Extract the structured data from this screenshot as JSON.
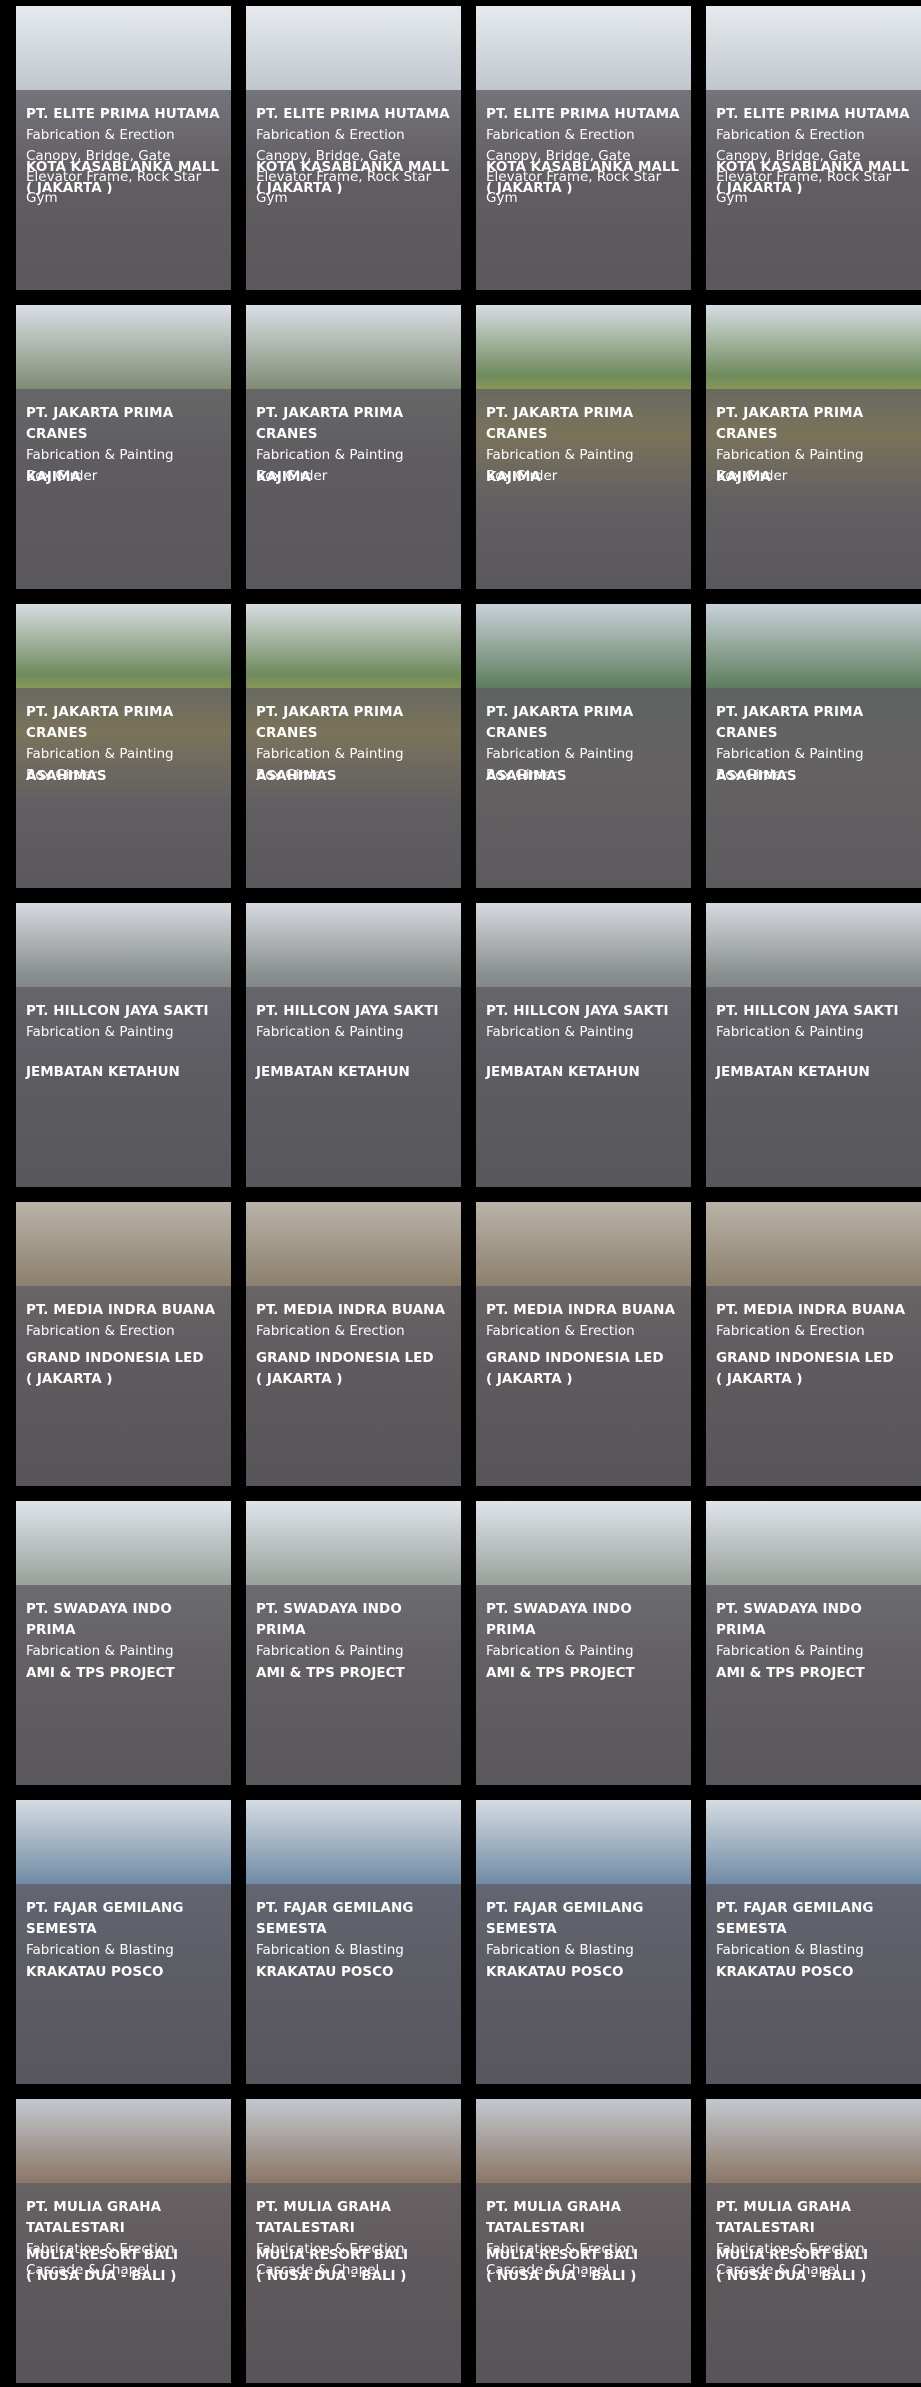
{
  "projects": [
    {
      "company": "PT. ELITE PRIMA HUTAMA",
      "description": "Fabrication & Erection\nCanopy, Bridge, Gate\nElevator Frame, Rock Star\nGym",
      "location": "KOTA KASABLANKA MALL\n( Jakarta )"
    },
    {
      "company": "PT. JAKARTA PRIMA CRANES",
      "description": "Fabrication & Painting\nBox Girder",
      "location": "KAJIMA"
    },
    {
      "company": "PT. JAKARTA PRIMA CRANES",
      "description": "Fabrication & Painting\nBox Girder",
      "location": "ASAHIMAS"
    },
    {
      "company": "PT. HILLCON JAYA SAKTI",
      "description": "Fabrication & Painting",
      "location": "JEMBATAN KETAHUN"
    },
    {
      "company": "PT. MEDIA INDRA BUANA",
      "description": "Fabrication & Erection",
      "location": "GRAND INDONESIA LED\n( Jakarta )"
    },
    {
      "company": "PT. SWADAYA INDO PRIMA",
      "description": "Fabrication & Painting",
      "location": "AMI & TPS PROJECT"
    },
    {
      "company": "PT. FAJAR GEMILANG SEMESTA",
      "description": "Fabrication & Blasting",
      "location": "KRAKATAU POSCO"
    },
    {
      "company": "PT. MULIA GRAHA TATALESTARI",
      "description": "Fabrication & Erection\nCascade & Chapel",
      "location": "MULIA RESORT BALI\n( Nusa Dua - Bali )"
    }
  ],
  "theme": {
    "background": "#000000",
    "overlay": "#5f5c64",
    "text": "#ffffff"
  }
}
